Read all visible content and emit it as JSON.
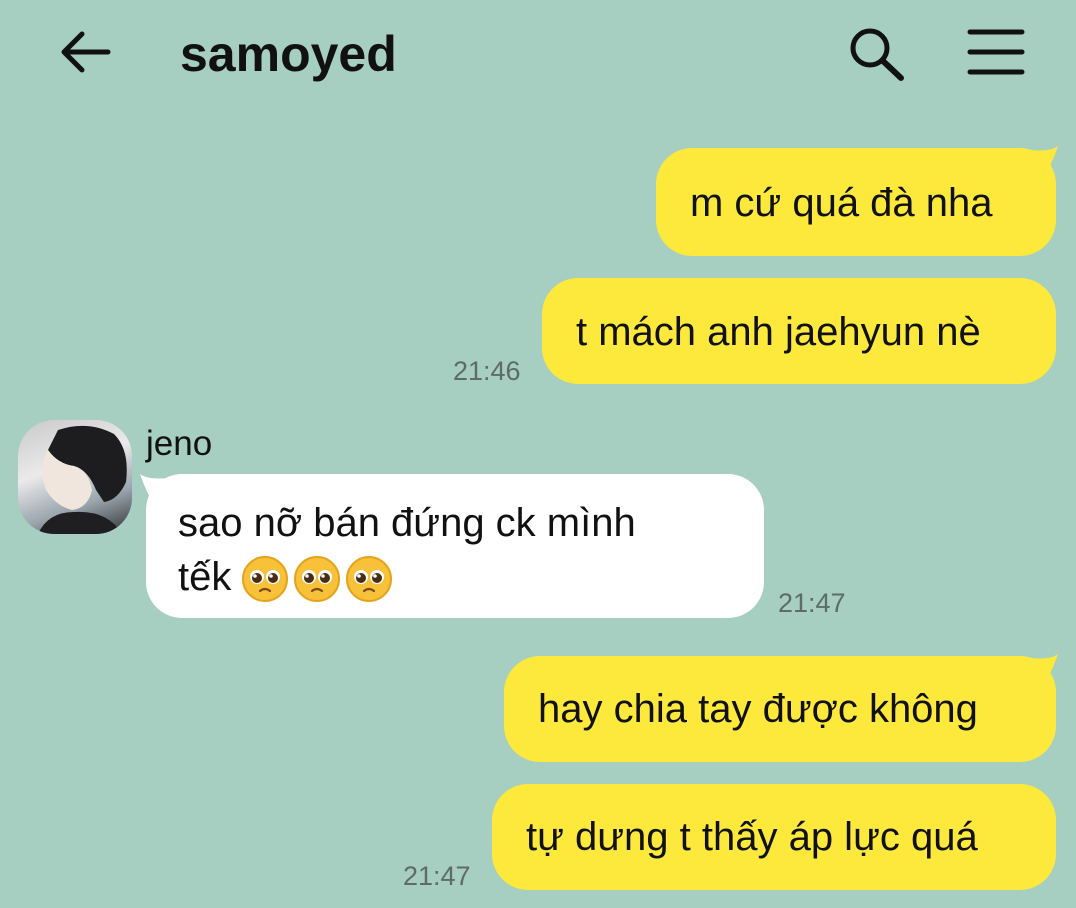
{
  "header": {
    "title": "samoyed",
    "back_icon": "arrow-left-icon",
    "search_icon": "search-icon",
    "menu_icon": "hamburger-menu-icon"
  },
  "messages": [
    {
      "side": "out",
      "text": "m cứ quá đà nha"
    },
    {
      "side": "out",
      "text": "t mách anh jaehyun nè",
      "time": "21:46"
    },
    {
      "side": "in",
      "sender": "jeno",
      "line1": "sao nỡ bán đứng ck mình",
      "line2": "tếk",
      "emoji": "pleading-face-emoji",
      "emoji_count": 3,
      "time": "21:47"
    },
    {
      "side": "out",
      "text": "hay chia tay được không"
    },
    {
      "side": "out",
      "text": "tự dưng t thấy áp lực quá",
      "time": "21:47"
    }
  ],
  "colors": {
    "background": "#a6cec1",
    "outgoing_bubble": "#fde93b",
    "incoming_bubble": "#ffffff"
  }
}
